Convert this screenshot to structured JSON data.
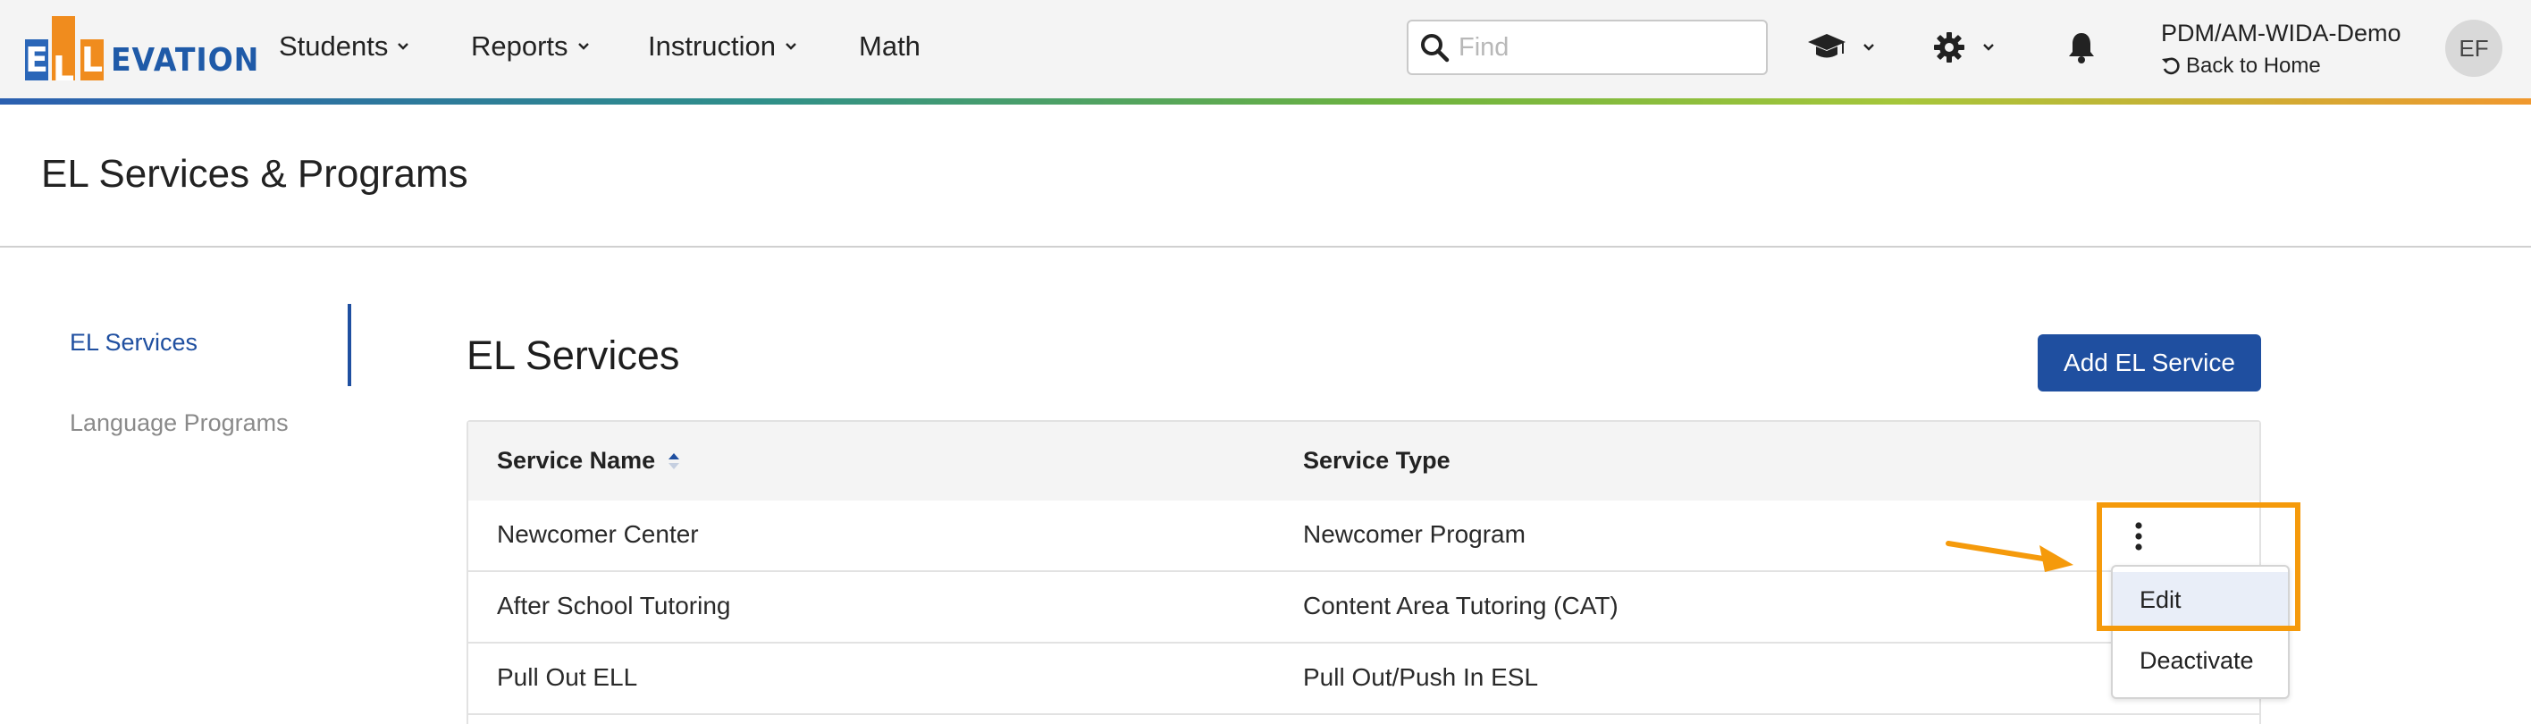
{
  "colors": {
    "brand_blue": "#1f4fa0",
    "logo_orange": "#f08c1e",
    "logo_blue": "#2a66b8",
    "annotation_orange": "#f59a0b"
  },
  "logo": {
    "letters": [
      "E",
      "L",
      "L"
    ],
    "rest": "EVATION"
  },
  "nav": {
    "items": [
      {
        "label": "Students",
        "has_dropdown": true
      },
      {
        "label": "Reports",
        "has_dropdown": true
      },
      {
        "label": "Instruction",
        "has_dropdown": true
      },
      {
        "label": "Math",
        "has_dropdown": false
      }
    ]
  },
  "search": {
    "placeholder": "Find",
    "value": "",
    "icon": "search-icon"
  },
  "top_icons": {
    "graduation": "graduation-cap-icon",
    "settings": "gear-icon",
    "notifications": "bell-icon"
  },
  "user": {
    "name": "PDM/AM-WIDA-Demo",
    "back_home": "Back to Home",
    "initials": "EF"
  },
  "page": {
    "title": "EL Services & Programs"
  },
  "sidebar": {
    "items": [
      {
        "label": "EL Services",
        "active": true
      },
      {
        "label": "Language Programs",
        "active": false
      }
    ]
  },
  "main": {
    "title": "EL Services",
    "add_button": "Add EL Service",
    "table": {
      "columns": [
        {
          "label": "Service Name",
          "sorted": "ascending"
        },
        {
          "label": "Service Type"
        }
      ],
      "rows": [
        {
          "name": "Newcomer Center",
          "type": "Newcomer Program"
        },
        {
          "name": "After School Tutoring",
          "type": "Content Area Tutoring (CAT)"
        },
        {
          "name": "Pull Out ELL",
          "type": "Pull Out/Push In ESL"
        }
      ]
    },
    "actions_menu": {
      "icon": "kebab-menu-icon",
      "items": [
        "Edit",
        "Deactivate"
      ],
      "hovered": "Edit"
    }
  }
}
